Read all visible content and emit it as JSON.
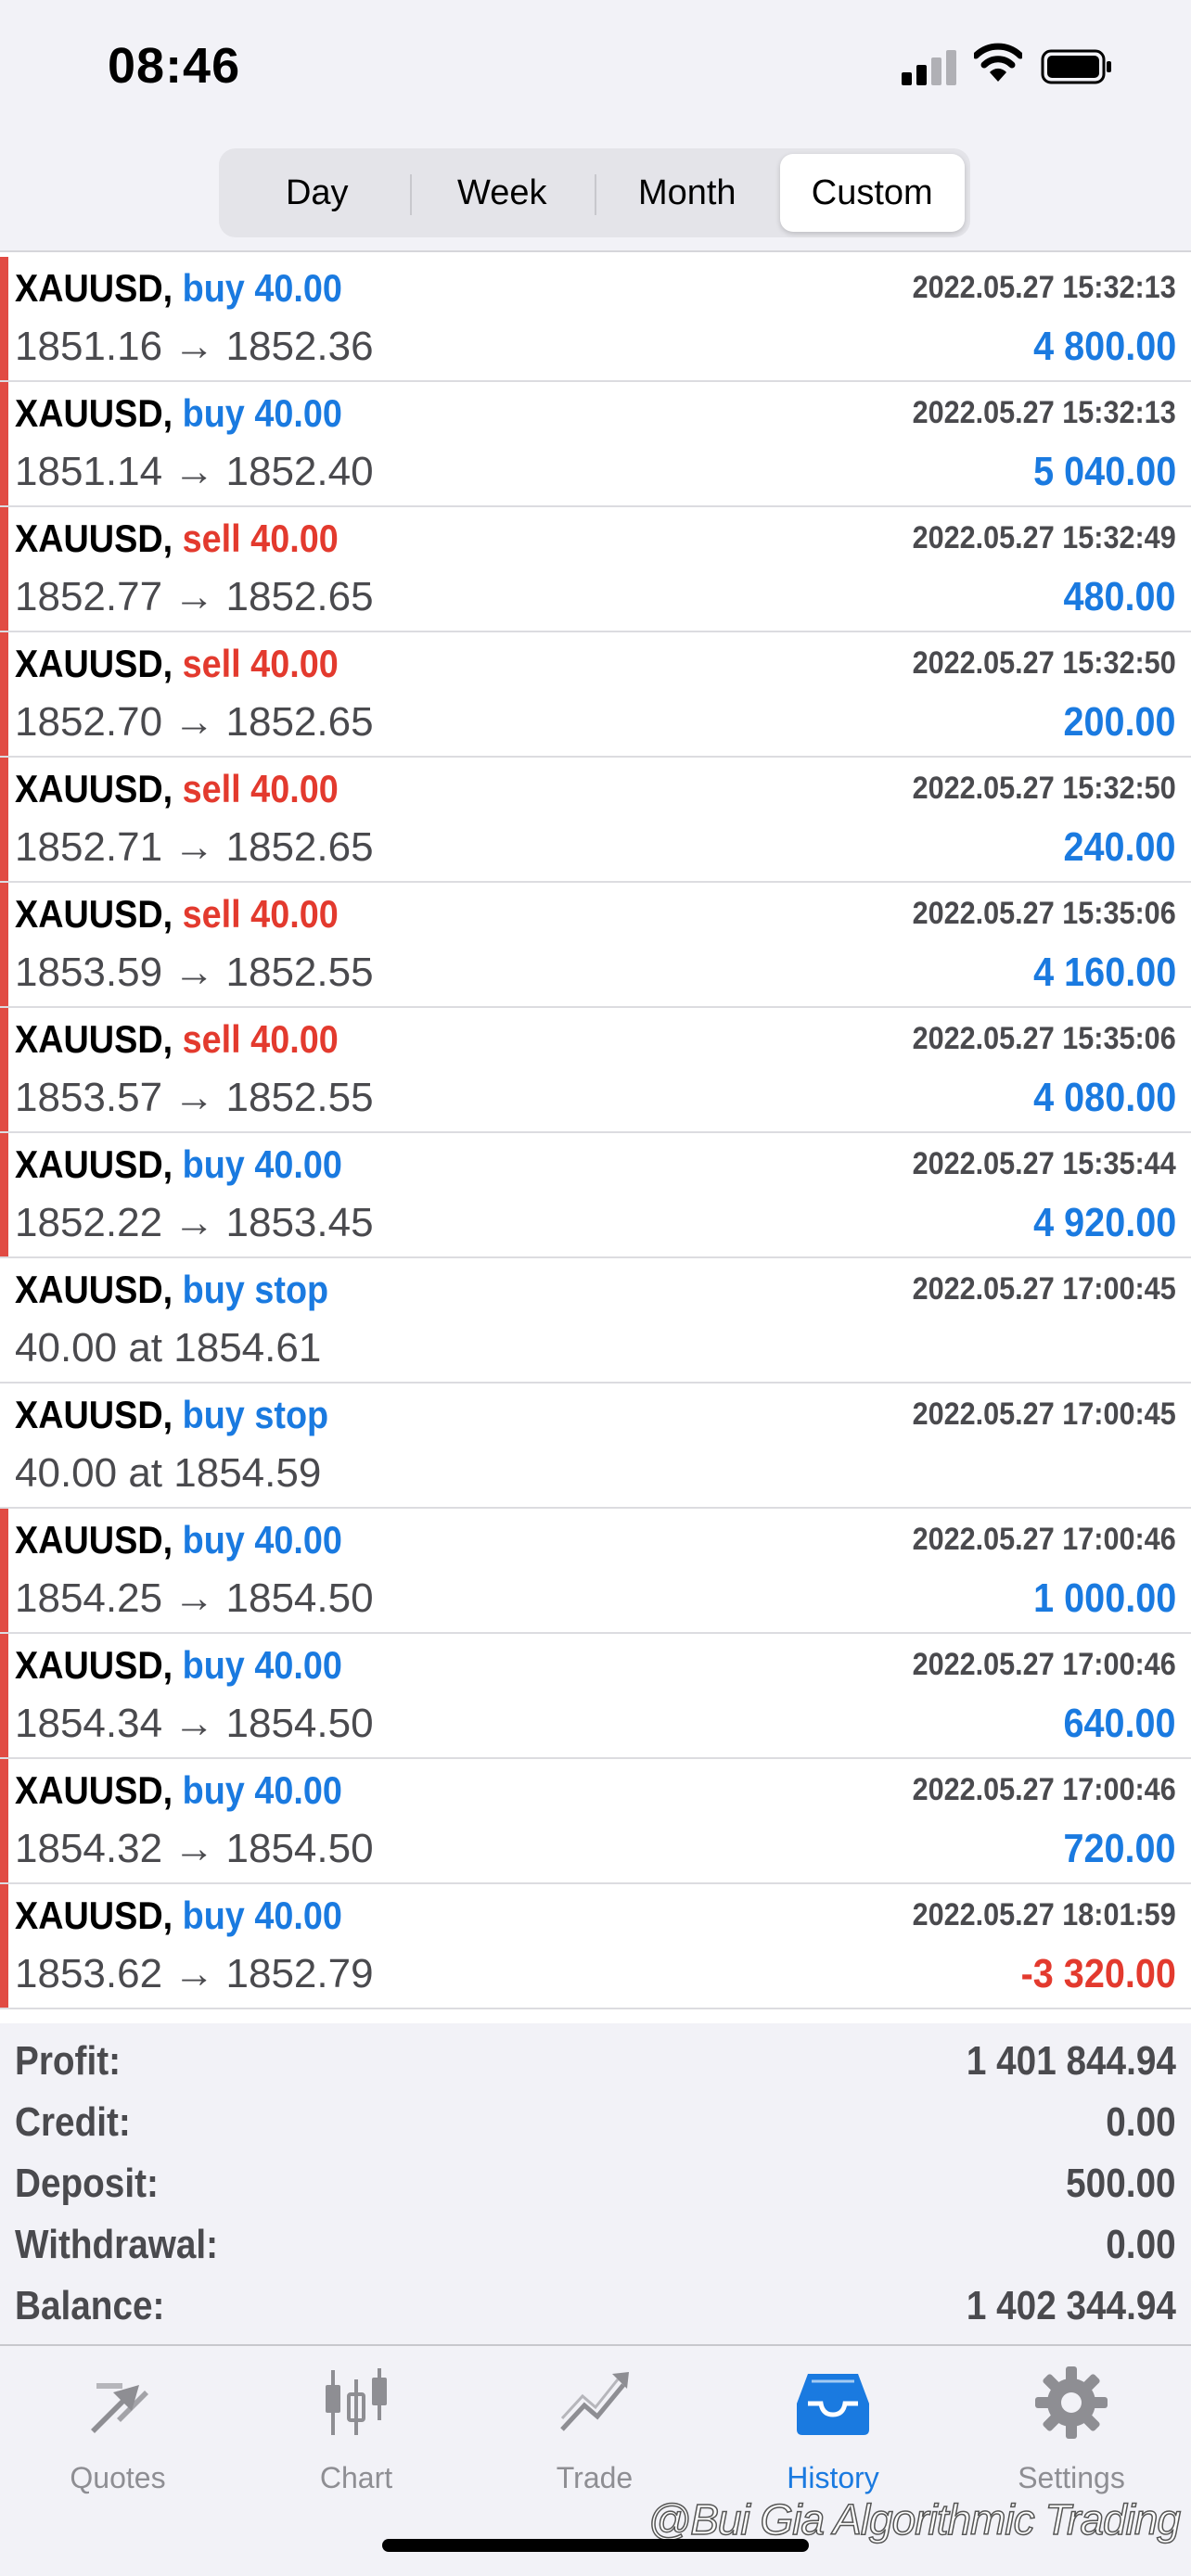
{
  "status": {
    "time": "08:46",
    "signal_icon": "cellular-signal-icon",
    "wifi_icon": "wifi-icon",
    "battery_icon": "battery-icon"
  },
  "periods": {
    "options": [
      "Day",
      "Week",
      "Month",
      "Custom"
    ],
    "selected": "Custom"
  },
  "colors": {
    "buy": "#1a7ae0",
    "sell": "#e33a2e",
    "marker": "#e14b43",
    "tab_active": "#1a7ae0",
    "tab_inactive": "#8e8e93"
  },
  "trades": [
    {
      "symbol": "XAUUSD,",
      "type": "buy 40.00",
      "side": "buy",
      "time": "2022.05.27 15:32:13",
      "prices": "1851.16 → 1852.36",
      "profit": "4 800.00",
      "marker": true
    },
    {
      "symbol": "XAUUSD,",
      "type": "buy 40.00",
      "side": "buy",
      "time": "2022.05.27 15:32:13",
      "prices": "1851.14 → 1852.40",
      "profit": "5 040.00",
      "marker": true
    },
    {
      "symbol": "XAUUSD,",
      "type": "sell 40.00",
      "side": "sell",
      "time": "2022.05.27 15:32:49",
      "prices": "1852.77 → 1852.65",
      "profit": "480.00",
      "marker": true
    },
    {
      "symbol": "XAUUSD,",
      "type": "sell 40.00",
      "side": "sell",
      "time": "2022.05.27 15:32:50",
      "prices": "1852.70 → 1852.65",
      "profit": "200.00",
      "marker": true
    },
    {
      "symbol": "XAUUSD,",
      "type": "sell 40.00",
      "side": "sell",
      "time": "2022.05.27 15:32:50",
      "prices": "1852.71 → 1852.65",
      "profit": "240.00",
      "marker": true
    },
    {
      "symbol": "XAUUSD,",
      "type": "sell 40.00",
      "side": "sell",
      "time": "2022.05.27 15:35:06",
      "prices": "1853.59 → 1852.55",
      "profit": "4 160.00",
      "marker": true
    },
    {
      "symbol": "XAUUSD,",
      "type": "sell 40.00",
      "side": "sell",
      "time": "2022.05.27 15:35:06",
      "prices": "1853.57 → 1852.55",
      "profit": "4 080.00",
      "marker": true
    },
    {
      "symbol": "XAUUSD,",
      "type": "buy 40.00",
      "side": "buy",
      "time": "2022.05.27 15:35:44",
      "prices": "1852.22 → 1853.45",
      "profit": "4 920.00",
      "marker": true
    },
    {
      "symbol": "XAUUSD,",
      "type": "buy stop",
      "side": "buy",
      "time": "2022.05.27 17:00:45",
      "prices": "40.00 at 1854.61",
      "profit": "",
      "marker": false
    },
    {
      "symbol": "XAUUSD,",
      "type": "buy stop",
      "side": "buy",
      "time": "2022.05.27 17:00:45",
      "prices": "40.00 at 1854.59",
      "profit": "",
      "marker": false
    },
    {
      "symbol": "XAUUSD,",
      "type": "buy 40.00",
      "side": "buy",
      "time": "2022.05.27 17:00:46",
      "prices": "1854.25 → 1854.50",
      "profit": "1 000.00",
      "marker": true
    },
    {
      "symbol": "XAUUSD,",
      "type": "buy 40.00",
      "side": "buy",
      "time": "2022.05.27 17:00:46",
      "prices": "1854.34 → 1854.50",
      "profit": "640.00",
      "marker": true
    },
    {
      "symbol": "XAUUSD,",
      "type": "buy 40.00",
      "side": "buy",
      "time": "2022.05.27 17:00:46",
      "prices": "1854.32 → 1854.50",
      "profit": "720.00",
      "marker": true
    },
    {
      "symbol": "XAUUSD,",
      "type": "buy 40.00",
      "side": "buy",
      "time": "2022.05.27 18:01:59",
      "prices": "1853.62 → 1852.79",
      "profit": "-3 320.00",
      "marker": true
    }
  ],
  "summary": [
    {
      "label": "Profit:",
      "value": "1 401 844.94"
    },
    {
      "label": "Credit:",
      "value": "0.00"
    },
    {
      "label": "Deposit:",
      "value": "500.00"
    },
    {
      "label": "Withdrawal:",
      "value": "0.00"
    },
    {
      "label": "Balance:",
      "value": "1 402 344.94"
    }
  ],
  "tabs": [
    {
      "label": "Quotes",
      "icon": "quotes-arrows-icon",
      "active": false
    },
    {
      "label": "Chart",
      "icon": "candlestick-chart-icon",
      "active": false
    },
    {
      "label": "Trade",
      "icon": "trade-trend-icon",
      "active": false
    },
    {
      "label": "History",
      "icon": "history-inbox-icon",
      "active": true
    },
    {
      "label": "Settings",
      "icon": "gear-icon",
      "active": false
    }
  ],
  "watermark": "@Bui Gia Algorithmic Trading"
}
